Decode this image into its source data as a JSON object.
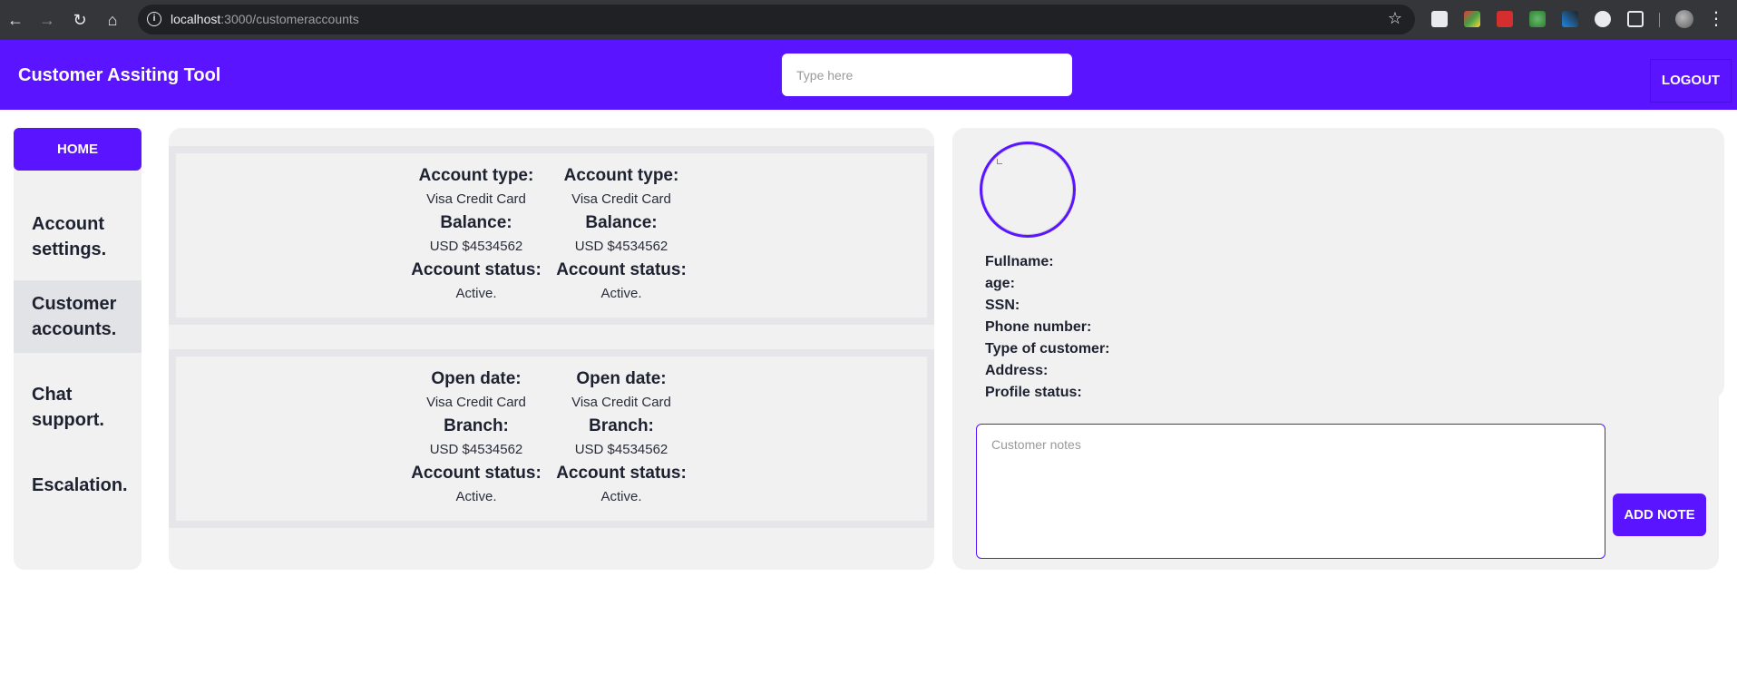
{
  "browser": {
    "url_host": "localhost",
    "url_path": ":3000/customeraccounts"
  },
  "header": {
    "title": "Customer Assiting Tool",
    "search_placeholder": "Type here",
    "logout_label": "LOGOUT"
  },
  "sidebar": {
    "home_label": "HOME",
    "items": [
      {
        "label": "Account settings.",
        "active": false
      },
      {
        "label": "Customer accounts.",
        "active": true
      },
      {
        "label": "Chat support.",
        "active": false
      },
      {
        "label": "Escalation.",
        "active": false
      }
    ]
  },
  "accounts": {
    "block1": [
      {
        "type_label": "Account type:",
        "type_value": "Visa Credit Card",
        "balance_label": "Balance:",
        "balance_value": "USD $4534562",
        "status_label": "Account status:",
        "status_value": "Active."
      },
      {
        "type_label": "Account type:",
        "type_value": "Visa Credit Card",
        "balance_label": "Balance:",
        "balance_value": "USD $4534562",
        "status_label": "Account status:",
        "status_value": "Active."
      }
    ],
    "block2": [
      {
        "type_label": "Open date:",
        "type_value": "Visa Credit Card",
        "balance_label": "Branch:",
        "balance_value": "USD $4534562",
        "status_label": "Account status:",
        "status_value": "Active."
      },
      {
        "type_label": "Open date:",
        "type_value": "Visa Credit Card",
        "balance_label": "Branch:",
        "balance_value": "USD $4534562",
        "status_label": "Account status:",
        "status_value": "Active."
      }
    ]
  },
  "profile": {
    "fields": [
      "Fullname:",
      "age:",
      "SSN:",
      "Phone number:",
      "Type of customer:",
      "Address:",
      "Profile status:"
    ],
    "notes_placeholder": "Customer notes",
    "add_note_label": "ADD NOTE"
  },
  "colors": {
    "brand": "#5a14ff",
    "panel": "#f1f1f2"
  }
}
